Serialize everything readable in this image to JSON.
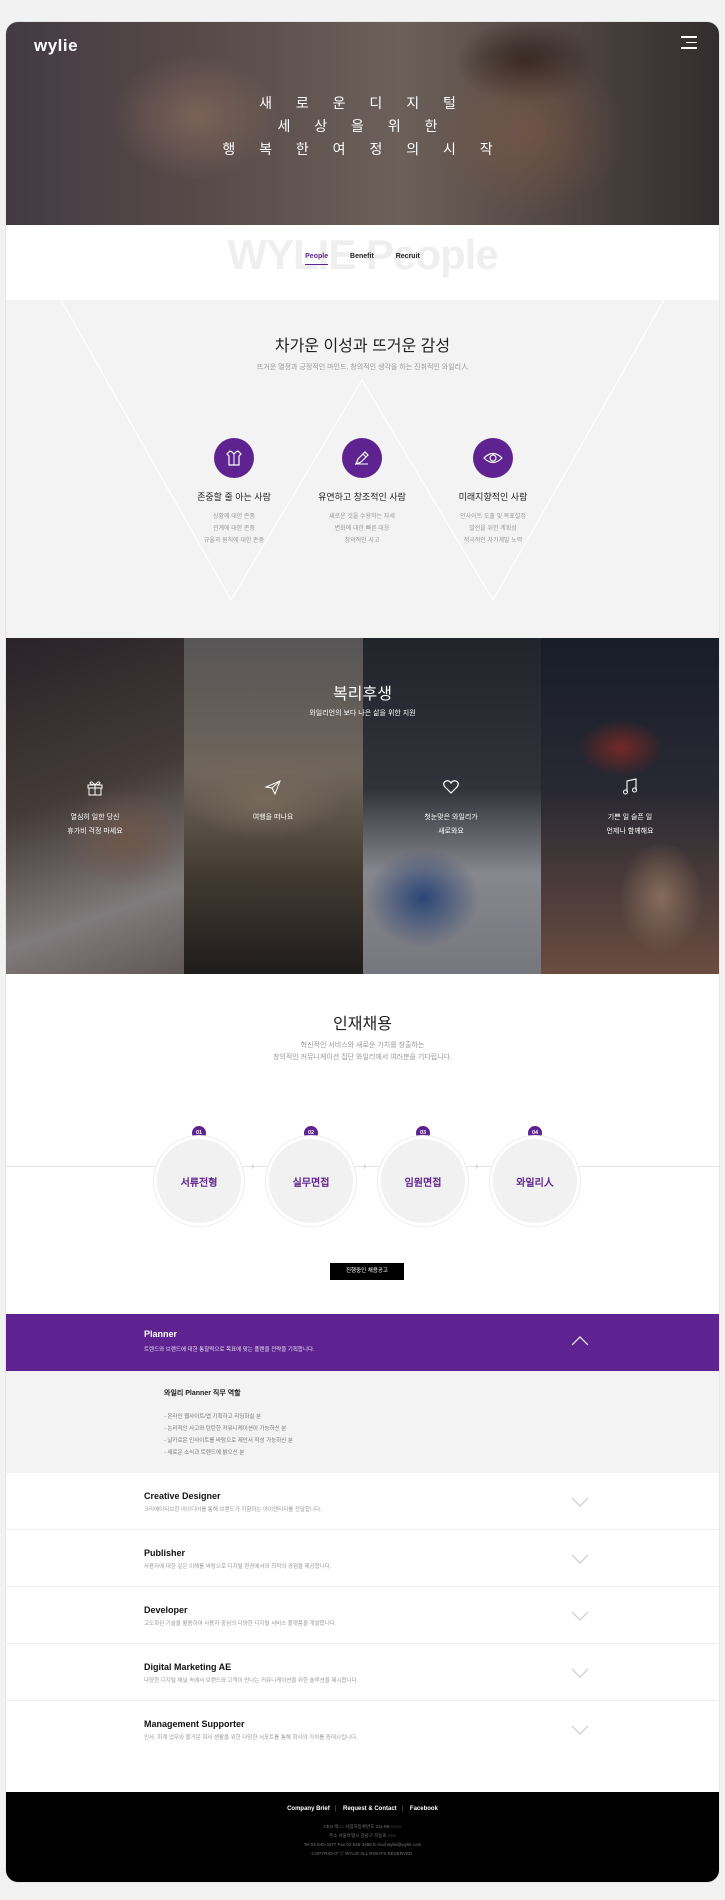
{
  "header": {
    "logo": "wylie",
    "hero_lines": [
      "새 로 운 디 지 털",
      "세 상 을 위 한",
      "행 복 한 여 정 의 시 작"
    ]
  },
  "tabs": {
    "ghost_text": "WYLIE People",
    "items": [
      {
        "label": "People",
        "active": true
      },
      {
        "label": "Benefit"
      },
      {
        "label": "Recruit"
      }
    ]
  },
  "people": {
    "title": "차가운 이성과 뜨거운 감성",
    "subtitle": "뜨거운 열정과 긍정적인 마인드, 창의적인 생각을 하는 진취적인 와일리人",
    "traits": [
      {
        "icon": "shirt-icon",
        "title": "존중할 줄 아는 사람",
        "lines": [
          "상황에 대한 존중",
          "관계에 대한 존중",
          "규율과 원칙에 대한 존중"
        ]
      },
      {
        "icon": "pen-icon",
        "title": "유연하고 창조적인 사람",
        "lines": [
          "새로운 것을 수용하는 자세",
          "변화에 대한 빠른 대응",
          "창의적인 사고"
        ]
      },
      {
        "icon": "eye-icon",
        "title": "미래지향적인 사람",
        "lines": [
          "인사이트 도출 및 목표설정",
          "발전을 위한 계획성",
          "적극적인 자기계발 노력"
        ]
      }
    ]
  },
  "benefit": {
    "title": "복리후생",
    "subtitle": "와일리언의 보다 나은 삶을 위한 지원",
    "items": [
      {
        "icon": "gift-icon",
        "lines": [
          "열심히 일한 당신",
          "휴가비 걱정 마세요"
        ]
      },
      {
        "icon": "paper-plane-icon",
        "lines": [
          "여행을 떠나요"
        ]
      },
      {
        "icon": "heart-icon",
        "lines": [
          "첫눈맞은 와일리가",
          "새로와요"
        ]
      },
      {
        "icon": "music-note-icon",
        "lines": [
          "기쁜 일 슬픈 일",
          "언제나 함께해요"
        ]
      }
    ]
  },
  "recruit": {
    "title": "인재채용",
    "subtitle_lines": [
      "혁신적인 서비스와 새로운 가치를 창출하는",
      "창의적인 커뮤니케이션 집단 와일리에서 여러분을 기다립니다."
    ],
    "steps": [
      {
        "num": "01",
        "label": "서류전형"
      },
      {
        "num": "02",
        "label": "실무면접"
      },
      {
        "num": "03",
        "label": "임원면접"
      },
      {
        "num": "04",
        "label": "와일리人"
      }
    ],
    "button": "진행중인 채용공고"
  },
  "jobs": {
    "open": {
      "title": "Planner",
      "desc": "트렌드와 브랜드에 대한 통찰력으로 목표에 맞는 플랜을 전략을 기획합니다.",
      "role_title": "와일리 Planner 직무 역할",
      "bullets": [
        "- 온라인 웹사이트/앱 기획하고 리딩하실 분",
        "- 논리적인 사고와 탄탄한 커뮤니케이션이 가능하신 분",
        "- 날카로운 인사이트를 바탕으로 제안서 작성 가능하신 분",
        "- 새로운 소식과 트렌드에 밝으신 분"
      ]
    },
    "rows": [
      {
        "title": "Creative Designer",
        "desc": "크리에이티브한 아이디어를 통해 브랜드가 지향하는 아이덴티티를 전달합니다."
      },
      {
        "title": "Publisher",
        "desc": "사용자에 대한 깊은 이해를 바탕으로 디지털 환경에서의 최적의 경험을 제공합니다."
      },
      {
        "title": "Developer",
        "desc": "고도화된 기술을 활용하여 사용자 중심의 다양한 디지털 서비스 플랫폼을 개발합니다."
      },
      {
        "title": "Digital Marketing AE",
        "desc": "다양한 디지털 채널 속에서 브랜드와 고객이 만나는 커뮤니케이션을 위한 솔루션을 제시합니다."
      },
      {
        "title": "Management Supporter",
        "desc": "인사, 회계 업무와 즐거운 회사 생활을 위한 다양한 서포트를 통해 회사의 가치를 증대시킵니다."
      }
    ]
  },
  "footer": {
    "links": [
      "Company Brief",
      "Request & Contact",
      "Facebook"
    ],
    "info": [
      "CEO 박○○  사업자등록번호 211-88-○○○○",
      "주소 서울특별시 강남구 학동로 ○○○",
      "Tel 02-545-3477  Fax 02-545-3488  E-mail wylie@wylie.com",
      "COPYRIGHT ⓒ WYLIE ALL RIGHTS RESERVED."
    ]
  },
  "colors": {
    "accent": "#5e2390",
    "footer_bg": "#000000"
  }
}
